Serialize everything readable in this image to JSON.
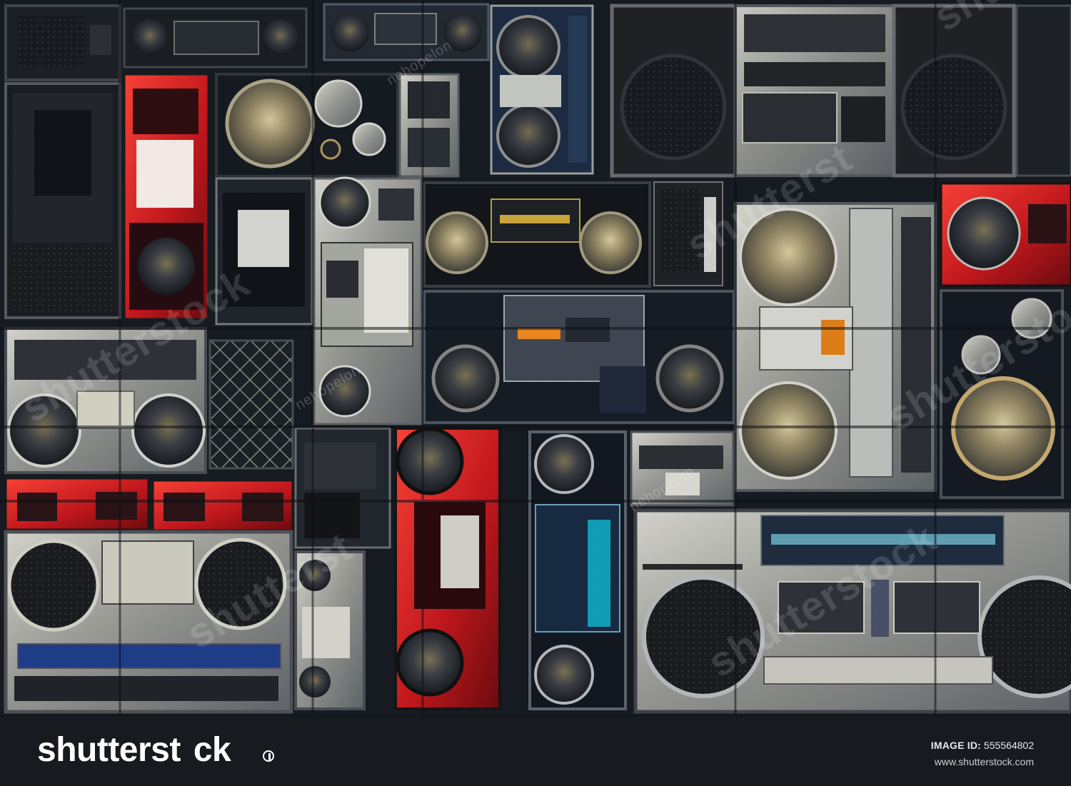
{
  "photo": {
    "subject": "Vintage radios and boomboxes wall",
    "watermarks": [
      "shutterstock",
      "shutterst",
      "shutterstock",
      "shutterstock",
      "shutterst",
      "shutterstock",
      "nehopelon",
      "nehopelon",
      "nehopelon"
    ]
  },
  "footer": {
    "brand": "shutterst",
    "brand_suffix": "ck",
    "image_id_label": "IMAGE ID:",
    "image_id_value": "555564802",
    "site": "www.shutterstock.com"
  },
  "colors": {
    "background": "#171b22",
    "photo_dark": "#20252d",
    "red_radio": "#d9252b",
    "silver_radio": "#a9aaa6",
    "blue_radio": "#2e4f87",
    "footer_text": "#ffffff"
  }
}
